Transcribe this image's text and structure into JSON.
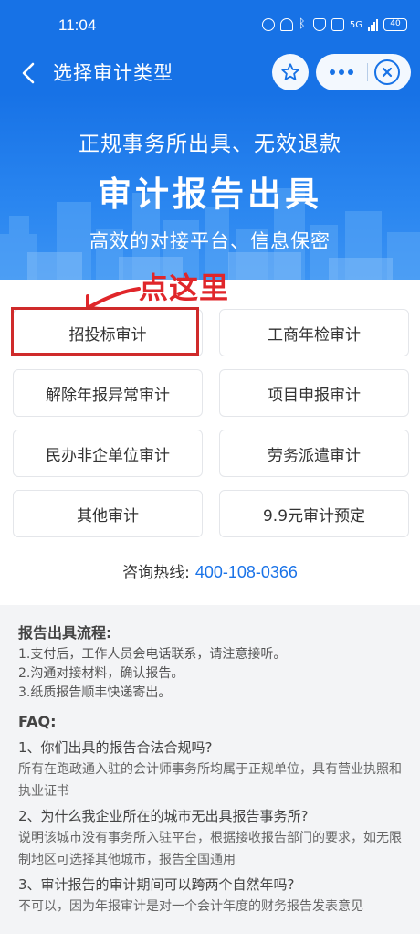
{
  "status_bar": {
    "time": "11:04",
    "network": "5G",
    "battery": "40"
  },
  "nav": {
    "title": "选择审计类型"
  },
  "banner": {
    "line1": "正规事务所出具、无效退款",
    "line2": "审计报告出具",
    "line3": "高效的对接平台、信息保密"
  },
  "annotation": "点这里",
  "options": [
    "招投标审计",
    "工商年检审计",
    "解除年报异常审计",
    "项目申报审计",
    "民办非企单位审计",
    "劳务派遣审计",
    "其他审计",
    "9.9元审计预定"
  ],
  "hotline": {
    "label": "咨询热线:",
    "number": "400-108-0366"
  },
  "process": {
    "title": "报告出具流程:",
    "steps": [
      "1.支付后，工作人员会电话联系，请注意接听。",
      "2.沟通对接材料，确认报告。",
      "3.纸质报告顺丰快递寄出。"
    ]
  },
  "faq": {
    "title": "FAQ:",
    "items": [
      {
        "q": "1、你们出具的报告合法合规吗?",
        "a": "所有在跑政通入驻的会计师事务所均属于正规单位，具有营业执照和执业证书"
      },
      {
        "q": "2、为什么我企业所在的城市无出具报告事务所?",
        "a": "说明该城市没有事务所入驻平台，根据接收报告部门的要求，如无限制地区可选择其他城市，报告全国通用"
      },
      {
        "q": "3、审计报告的审计期间可以跨两个自然年吗?",
        "a": "不可以，因为年报审计是对一个会计年度的财务报告发表意见"
      }
    ]
  },
  "colors": {
    "brand_blue": "#1772e6",
    "link_blue": "#1a73e8",
    "annotation_red": "#e0262a"
  }
}
